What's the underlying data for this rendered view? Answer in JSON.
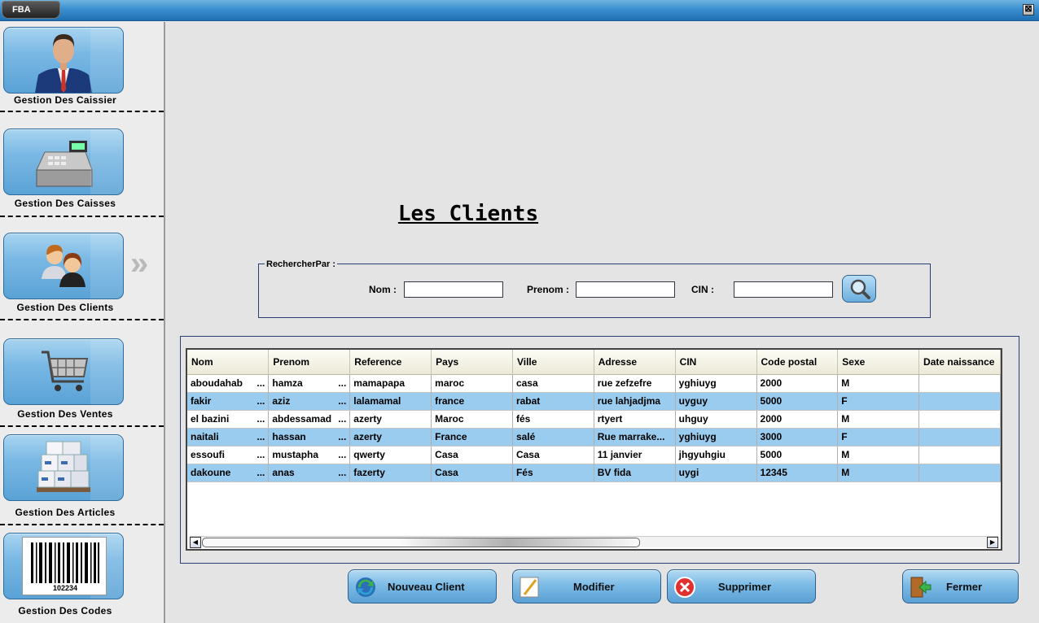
{
  "window": {
    "app_tab": "FBA",
    "close_glyph": "⊠"
  },
  "sidebar": {
    "items": [
      {
        "label": "Gestion Des Caissier",
        "icon": "businessman-icon"
      },
      {
        "label": "Gestion Des Caisses",
        "icon": "cash-register-icon"
      },
      {
        "label": "Gestion Des Clients",
        "icon": "clients-icon"
      },
      {
        "label": "Gestion Des Ventes",
        "icon": "shopping-cart-icon"
      },
      {
        "label": "Gestion Des Articles",
        "icon": "boxes-icon"
      },
      {
        "label": "Gestion Des Codes",
        "icon": "barcode-icon"
      }
    ],
    "barcode_number": "102234",
    "active_indicator": "»"
  },
  "main": {
    "title": "Les Clients",
    "search": {
      "legend": "RechercherPar :",
      "nom_label": "Nom :",
      "prenom_label": "Prenom :",
      "cin_label": "CIN :",
      "nom_value": "",
      "prenom_value": "",
      "cin_value": ""
    },
    "table": {
      "columns": [
        "Nom",
        "Prenom",
        "Reference",
        "Pays",
        "Ville",
        "Adresse",
        "CIN",
        "Code postal",
        "Sexe",
        "Date naissance"
      ],
      "rows": [
        [
          "aboudahab",
          "hamza",
          "mamapapa",
          "maroc",
          "casa",
          "rue zefzefre",
          "yghiuyg",
          "2000",
          "M",
          ""
        ],
        [
          "fakir",
          "aziz",
          "lalamamal",
          "france",
          "rabat",
          "rue lahjadjma",
          "uyguy",
          "5000",
          "F",
          ""
        ],
        [
          "el bazini",
          "abdessamad",
          "azerty",
          "Maroc",
          "fés",
          "rtyert",
          "uhguy",
          "2000",
          "M",
          ""
        ],
        [
          "naitali",
          "hassan",
          "azerty",
          "France",
          "salé",
          "Rue marrake...",
          "yghiuyg",
          "3000",
          "F",
          ""
        ],
        [
          "essoufi",
          "mustapha",
          "qwerty",
          "Casa",
          "Casa",
          "11 janvier",
          "jhgyuhgiu",
          "5000",
          "M",
          ""
        ],
        [
          "dakoune",
          "anas",
          "fazerty",
          "Casa",
          "Fés",
          "BV fida",
          "uygi",
          "12345",
          "M",
          ""
        ]
      ],
      "ellipsis": "..."
    },
    "buttons": {
      "nouveau": "Nouveau Client",
      "modifier": "Modifier",
      "supprimer": "Supprimer",
      "fermer": "Fermer"
    }
  },
  "colors": {
    "accent": "#5aa2d6",
    "row_alt": "#99ccef",
    "frame": "#2a3e78"
  }
}
